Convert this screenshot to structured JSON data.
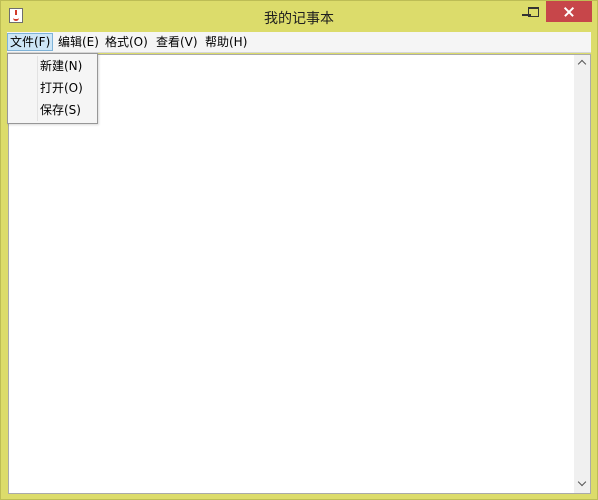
{
  "window": {
    "title": "我的记事本",
    "frame_color": "#dcdc6b",
    "close_color": "#c7464a",
    "icon": "java-cup-icon"
  },
  "menubar": {
    "items": [
      {
        "label": "文件(F)",
        "active": true
      },
      {
        "label": "编辑(E)"
      },
      {
        "label": "格式(O)"
      },
      {
        "label": "查看(V)"
      },
      {
        "label": "帮助(H)"
      }
    ]
  },
  "file_menu": {
    "items": [
      {
        "label": "新建(N)"
      },
      {
        "label": "打开(O)"
      },
      {
        "label": "保存(S)"
      }
    ]
  },
  "editor": {
    "content": ""
  }
}
